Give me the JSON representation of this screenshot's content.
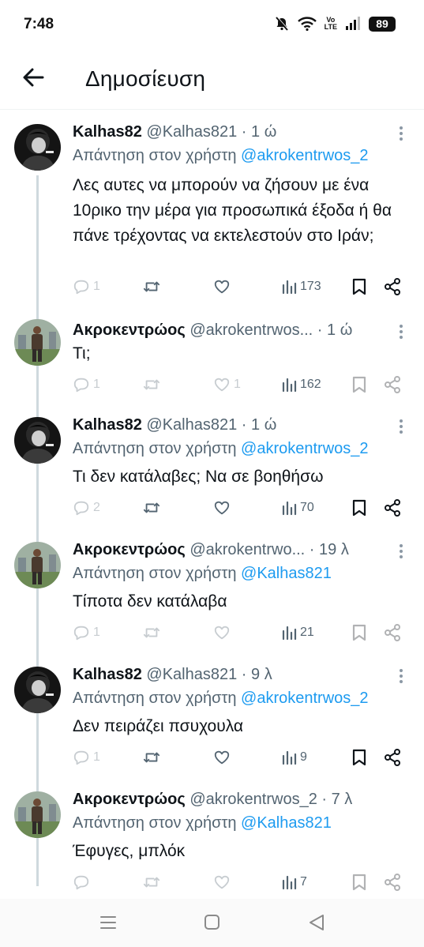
{
  "status_bar": {
    "time": "7:48",
    "volte_line1": "Vo",
    "volte_line2": "LTE",
    "battery": "89"
  },
  "header": {
    "title": "Δημοσίευση"
  },
  "tweets": [
    {
      "name": "Kalhas82",
      "handle": "@Kalhas821",
      "dot": " · ",
      "time": "1 ώ",
      "reply_prefix": "Απάντηση στον χρήστη ",
      "reply_to": "@akrokentrwos_2",
      "text": "Λες αυτες να μπορούν να ζήσουν με ένα 10ρικο την μέρα για προσωπικά έξοδα ή θα πάνε τρέχοντας να εκτελεστούν στο Ιράν;",
      "replies": "1",
      "reposts": "",
      "likes": "",
      "views": "173"
    },
    {
      "name": "Ακροκεντρώος",
      "handle": "@akrokentrwos...",
      "dot": " · ",
      "time": "1 ώ",
      "reply_prefix": "",
      "reply_to": "",
      "text": "Τι;",
      "replies": "1",
      "reposts": "",
      "likes": "1",
      "views": "162"
    },
    {
      "name": "Kalhas82",
      "handle": "@Kalhas821",
      "dot": " · ",
      "time": "1 ώ",
      "reply_prefix": "Απάντηση στον χρήστη ",
      "reply_to": "@akrokentrwos_2",
      "text": "Τι δεν κατάλαβες; Να σε βοηθήσω",
      "replies": "2",
      "reposts": "",
      "likes": "",
      "views": "70"
    },
    {
      "name": "Ακροκεντρώος",
      "handle": "@akrokentrwo...",
      "dot": " · ",
      "time": "19 λ",
      "reply_prefix": "Απάντηση στον χρήστη ",
      "reply_to": "@Kalhas821",
      "text": "Τίποτα δεν κατάλαβα",
      "replies": "1",
      "reposts": "",
      "likes": "",
      "views": "21"
    },
    {
      "name": "Kalhas82",
      "handle": "@Kalhas821",
      "dot": " · ",
      "time": "9 λ",
      "reply_prefix": "Απάντηση στον χρήστη ",
      "reply_to": "@akrokentrwos_2",
      "text": "Δεν πειράζει πσυχουλα",
      "replies": "1",
      "reposts": "",
      "likes": "",
      "views": "9"
    },
    {
      "name": "Ακροκεντρώος",
      "handle": "@akrokentrwos_2",
      "dot": " · ",
      "time": "7 λ",
      "reply_prefix": "Απάντηση στον χρήστη ",
      "reply_to": "@Kalhas821",
      "text": "Έφυγες, μπλόκ",
      "replies": "",
      "reposts": "",
      "likes": "",
      "views": "7"
    }
  ],
  "icons": {
    "reply": "reply-icon",
    "repost": "repost-icon",
    "like": "like-icon",
    "views": "views-icon",
    "bookmark": "bookmark-icon",
    "share": "share-icon"
  },
  "colors": {
    "text": "#0f1419",
    "muted": "#536471",
    "link": "#1d9bf0",
    "thread_line": "#cfd9de"
  }
}
